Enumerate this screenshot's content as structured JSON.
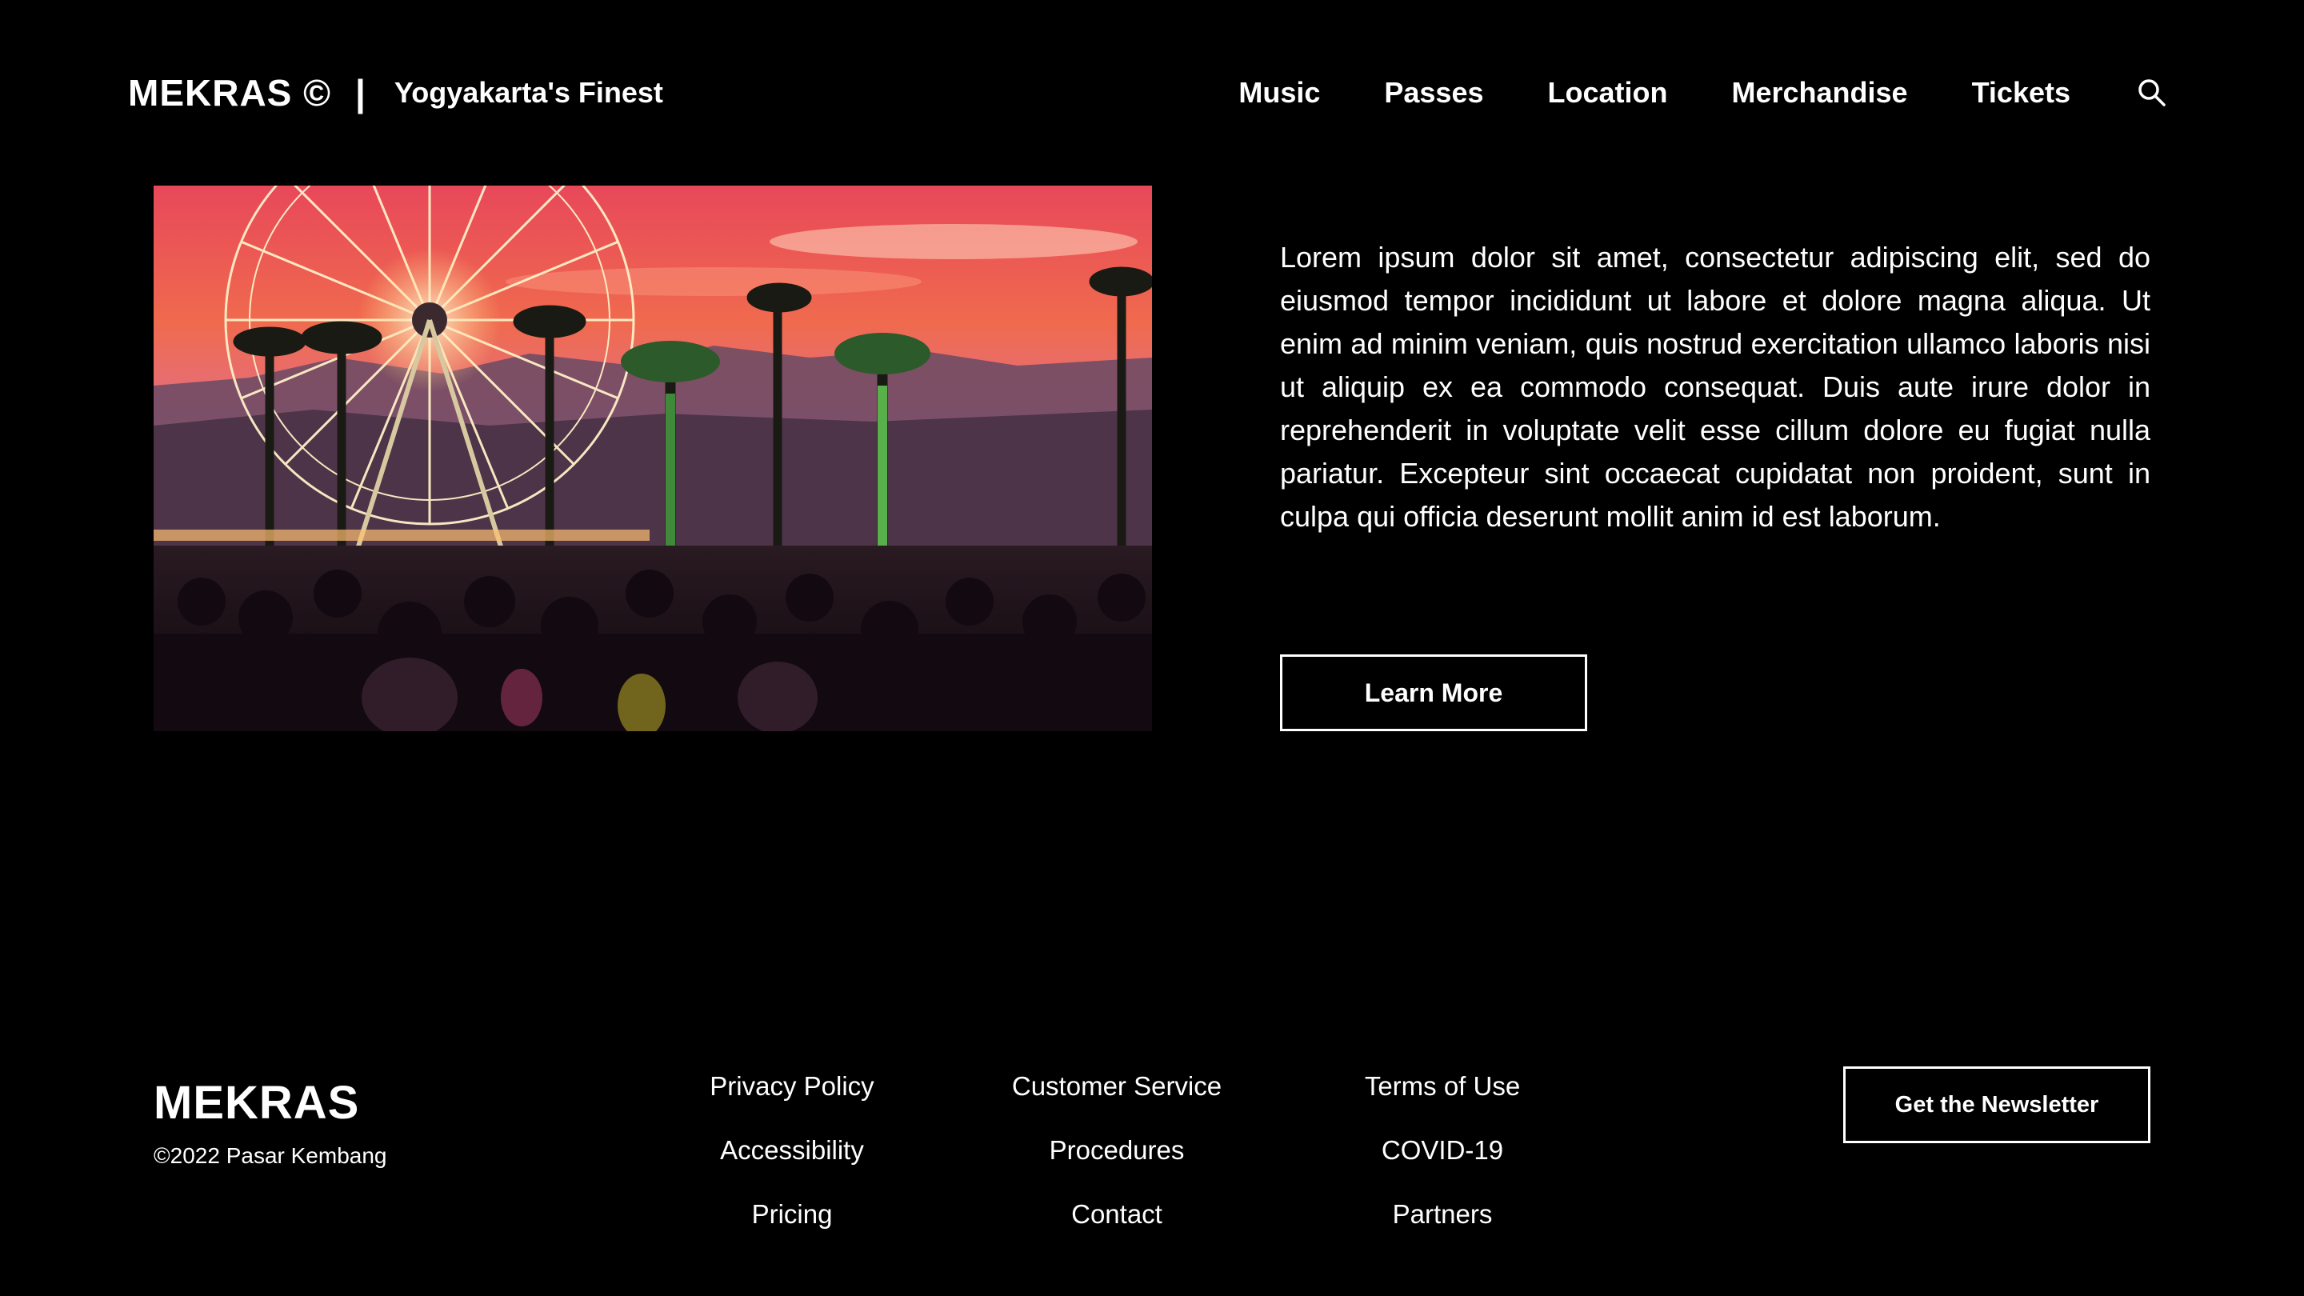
{
  "header": {
    "brand_name": "MEKRAS ©",
    "separator": "|",
    "tagline": "Yogyakarta's Finest",
    "nav": [
      "Music",
      "Passes",
      "Location",
      "Merchandise",
      "Tickets"
    ],
    "search_icon": "search-icon"
  },
  "hero": {
    "image_subject": "festival-ferris-wheel-sunset-crowd",
    "paragraph": "Lorem ipsum dolor sit amet, consectetur adipiscing elit, sed do eiusmod tempor incididunt ut labore et dolore magna aliqua. Ut enim ad minim veniam, quis nostrud exercitation ullamco laboris nisi ut aliquip ex ea commodo consequat. Duis aute irure dolor in reprehenderit in voluptate velit esse cillum dolore eu fugiat nulla pariatur. Excepteur sint occaecat cupidatat non proident, sunt in culpa qui officia deserunt mollit anim id est laborum.",
    "cta_label": "Learn More"
  },
  "footer": {
    "brand": "MEKRAS",
    "copyright": "©2022 Pasar Kembang",
    "columns": [
      [
        "Privacy Policy",
        "Accessibility",
        "Pricing"
      ],
      [
        "Customer Service",
        "Procedures",
        "Contact"
      ],
      [
        "Terms of Use",
        "COVID-19",
        "Partners"
      ]
    ],
    "newsletter_label": "Get the Newsletter"
  },
  "colors": {
    "background": "#000000",
    "text": "#ffffff"
  }
}
